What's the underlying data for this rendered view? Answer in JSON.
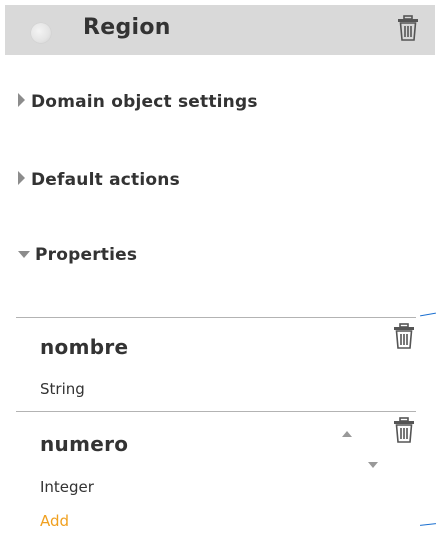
{
  "entity": {
    "title": "Region"
  },
  "sections": {
    "domain_object_settings": "Domain object settings",
    "default_actions": "Default actions",
    "properties": "Properties"
  },
  "properties": [
    {
      "name": "nombre",
      "type": "String"
    },
    {
      "name": "numero",
      "type": "Integer"
    }
  ],
  "actions": {
    "add_label": "Add"
  },
  "colors": {
    "header_bg": "#d9d9d9",
    "add_link": "#f0a020",
    "connector": "#1a6fd0"
  },
  "icons": {
    "delete": "trash-icon",
    "entity": "circle-icon",
    "collapsed": "caret-right-icon",
    "expanded": "caret-down-icon",
    "move_up": "arrow-up-icon",
    "move_down": "arrow-down-icon"
  }
}
